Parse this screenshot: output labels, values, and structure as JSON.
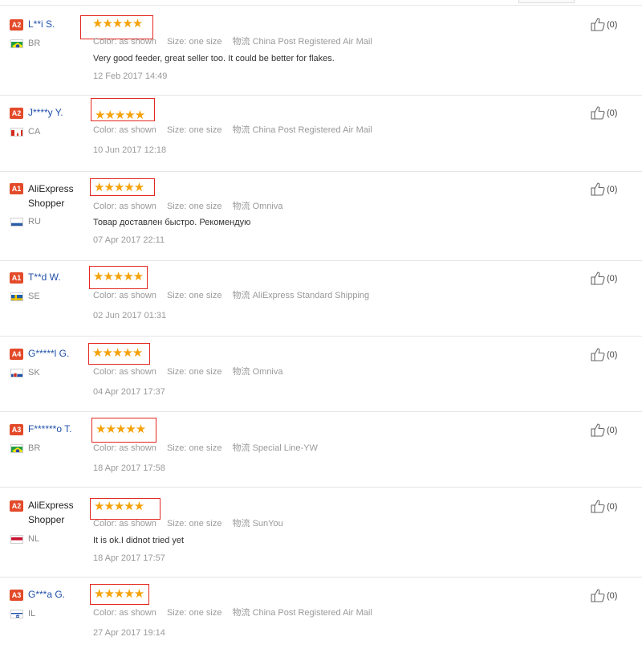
{
  "labels": {
    "color": "Color:",
    "size": "Size:",
    "logistics": "物流"
  },
  "reviews": [
    {
      "badge": "A2",
      "name": "L**i S.",
      "country": "BR",
      "rating": 5,
      "stars": "★★★★★",
      "color": "as shown",
      "size": "one size",
      "logistics": "China Post Registered Air Mail",
      "comment": "Very good feeder, great seller too. It could be better for flakes.",
      "date": "12 Feb 2017 14:49",
      "helpful": "(0)"
    },
    {
      "badge": "A2",
      "name": "J****y Y.",
      "country": "CA",
      "rating": 5,
      "stars": "★★★★★",
      "color": "as shown",
      "size": "one size",
      "logistics": "China Post Registered Air Mail",
      "comment": "",
      "date": "10 Jun 2017 12:18",
      "helpful": "(0)"
    },
    {
      "badge": "A1",
      "name": "AliExpress Shopper",
      "country": "RU",
      "rating": 5,
      "stars": "★★★★★",
      "color": "as shown",
      "size": "one size",
      "logistics": "Omniva",
      "comment": "Товар доставлен быстро. Рекомендую",
      "date": "07 Apr 2017 22:11",
      "helpful": "(0)"
    },
    {
      "badge": "A1",
      "name": "T**d W.",
      "country": "SE",
      "rating": 5,
      "stars": "★★★★★",
      "color": "as shown",
      "size": "one size",
      "logistics": "AliExpress Standard Shipping",
      "comment": "",
      "date": "02 Jun 2017 01:31",
      "helpful": "(0)"
    },
    {
      "badge": "A4",
      "name": "G*****l G.",
      "country": "SK",
      "rating": 5,
      "stars": "★★★★★",
      "color": "as shown",
      "size": "one size",
      "logistics": "Omniva",
      "comment": "",
      "date": "04 Apr 2017 17:37",
      "helpful": "(0)"
    },
    {
      "badge": "A3",
      "name": "F******o T.",
      "country": "BR",
      "rating": 5,
      "stars": "★★★★★",
      "color": "as shown",
      "size": "one size",
      "logistics": "Special Line-YW",
      "comment": "",
      "date": "18 Apr 2017 17:58",
      "helpful": "(0)"
    },
    {
      "badge": "A2",
      "name": "AliExpress Shopper",
      "country": "NL",
      "rating": 5,
      "stars": "★★★★★",
      "color": "as shown",
      "size": "one size",
      "logistics": "SunYou",
      "comment": "It is ok.I didnot tried yet",
      "date": "18 Apr 2017 17:57",
      "helpful": "(0)"
    },
    {
      "badge": "A3",
      "name": "G***a G.",
      "country": "IL",
      "rating": 5,
      "stars": "★★★★★",
      "color": "as shown",
      "size": "one size",
      "logistics": "China Post Registered Air Mail",
      "comment": "",
      "date": "27 Apr 2017 19:14",
      "helpful": "(0)"
    }
  ]
}
